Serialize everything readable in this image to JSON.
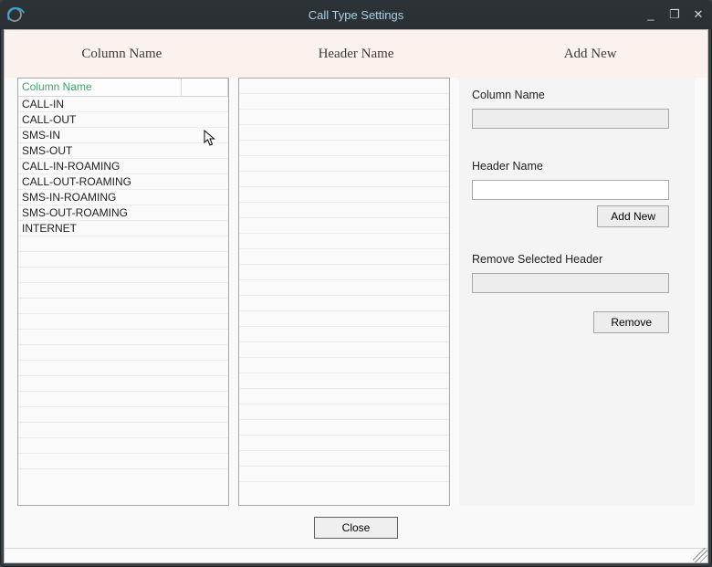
{
  "window": {
    "title": "Call Type Settings",
    "controls": {
      "min": "_",
      "max": "❐",
      "close": "✕"
    }
  },
  "sections": {
    "col1": "Column Name",
    "col2": "Header Name",
    "col3": "Add New"
  },
  "column_grid": {
    "header": "Column Name",
    "rows": [
      "CALL-IN",
      "CALL-OUT",
      "SMS-IN",
      "SMS-OUT",
      "CALL-IN-ROAMING",
      "CALL-OUT-ROAMING",
      "SMS-IN-ROAMING",
      "SMS-OUT-ROAMING",
      "INTERNET"
    ]
  },
  "header_grid": {
    "rows": []
  },
  "form": {
    "column_name_label": "Column Name",
    "column_name_value": "",
    "header_name_label": "Header Name",
    "header_name_value": "",
    "add_new_button": "Add New",
    "remove_section_label": "Remove Selected Header",
    "remove_selected_value": "",
    "remove_button": "Remove"
  },
  "footer": {
    "close_button": "Close"
  }
}
